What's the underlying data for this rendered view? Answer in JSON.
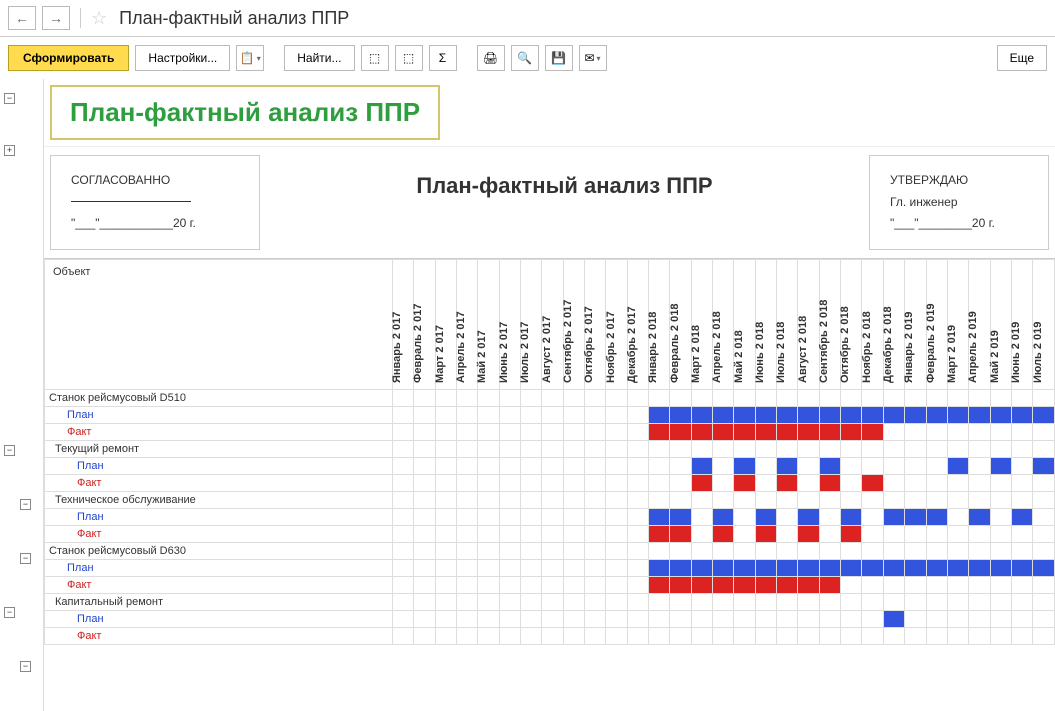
{
  "header": {
    "title": "План-фактный анализ ППР"
  },
  "toolbar": {
    "form": "Сформировать",
    "settings": "Настройки...",
    "find": "Найти...",
    "more": "Еще"
  },
  "report": {
    "title": "План-фактный анализ ППР",
    "doc_title": "План-фактный анализ ППР",
    "approval_left": {
      "label": "СОГЛАСОВАННО",
      "date_template": "\"___\"___________20    г."
    },
    "approval_right": {
      "label": "УТВЕРЖДАЮ",
      "position": "Гл. инженер",
      "date_template": "\"___\"________20    г."
    },
    "object_label": "Объект"
  },
  "chart_data": {
    "type": "gantt",
    "months": [
      "Январь 2 017",
      "Февраль 2 017",
      "Март 2 017",
      "Апрель 2 017",
      "Май 2 017",
      "Июнь 2 017",
      "Июль 2 017",
      "Август 2 017",
      "Сентябрь 2 017",
      "Октябрь 2 017",
      "Ноябрь 2 017",
      "Декабрь 2 017",
      "Январь 2 018",
      "Февраль 2 018",
      "Март 2 018",
      "Апрель 2 018",
      "Май 2 018",
      "Июнь 2 018",
      "Июль 2 018",
      "Август 2 018",
      "Сентябрь 2 018",
      "Октябрь 2 018",
      "Ноябрь 2 018",
      "Декабрь 2 018",
      "Январь 2 019",
      "Февраль 2 019",
      "Март 2 019",
      "Апрель 2 019",
      "Май 2 019",
      "Июнь 2 019",
      "Июль 2 019"
    ],
    "rows": [
      {
        "label": "Станок рейсмусовый D510",
        "type": "obj",
        "level": 0,
        "cells": []
      },
      {
        "label": "План",
        "type": "plan",
        "level": 1,
        "cells": [
          12,
          13,
          14,
          15,
          16,
          17,
          18,
          19,
          20,
          21,
          22,
          23,
          24,
          25,
          26,
          27,
          28,
          29,
          30
        ]
      },
      {
        "label": "Факт",
        "type": "fakt",
        "level": 1,
        "cells": [
          12,
          13,
          14,
          15,
          16,
          17,
          18,
          19,
          20,
          21,
          22
        ]
      },
      {
        "label": "Текущий ремонт",
        "type": "sub",
        "level": 1,
        "cells": []
      },
      {
        "label": "План",
        "type": "plan",
        "level": 2,
        "cells": [
          14,
          16,
          18,
          20,
          26,
          28,
          30
        ]
      },
      {
        "label": "Факт",
        "type": "fakt",
        "level": 2,
        "cells": [
          14,
          16,
          18,
          20,
          22
        ]
      },
      {
        "label": "Техническое обслуживание",
        "type": "sub",
        "level": 1,
        "cells": []
      },
      {
        "label": "План",
        "type": "plan",
        "level": 2,
        "cells": [
          12,
          13,
          15,
          17,
          19,
          21,
          23,
          24,
          25,
          27,
          29
        ]
      },
      {
        "label": "Факт",
        "type": "fakt",
        "level": 2,
        "cells": [
          12,
          13,
          15,
          17,
          19,
          21
        ]
      },
      {
        "label": "Станок рейсмусовый D630",
        "type": "obj",
        "level": 0,
        "cells": []
      },
      {
        "label": "План",
        "type": "plan",
        "level": 1,
        "cells": [
          12,
          13,
          14,
          15,
          16,
          17,
          18,
          19,
          20,
          21,
          22,
          23,
          24,
          25,
          26,
          27,
          28,
          29,
          30
        ]
      },
      {
        "label": "Факт",
        "type": "fakt",
        "level": 1,
        "cells": [
          12,
          13,
          14,
          15,
          16,
          17,
          18,
          19,
          20
        ]
      },
      {
        "label": "Капитальный ремонт",
        "type": "sub",
        "level": 1,
        "cells": []
      },
      {
        "label": "План",
        "type": "plan",
        "level": 2,
        "cells": [
          23
        ]
      },
      {
        "label": "Факт",
        "type": "fakt",
        "level": 2,
        "cells": []
      }
    ]
  }
}
